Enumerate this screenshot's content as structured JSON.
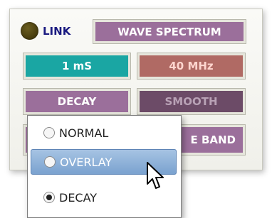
{
  "indicator": {
    "label": "LINK"
  },
  "buttons": {
    "title": "WAVE SPECTRUM",
    "time": "1 mS",
    "freq": "40 MHz",
    "mode": "DECAY",
    "smooth": "SMOOTH",
    "band_partial": "E BAND"
  },
  "menu": {
    "items": [
      {
        "label": "NORMAL",
        "checked": false
      },
      {
        "label": "OVERLAY",
        "checked": false
      },
      {
        "label": "DECAY",
        "checked": true
      }
    ],
    "highlighted": "OVERLAY"
  },
  "colors": {
    "purple": "#9b6f9b",
    "teal": "#1aa6a3",
    "red": "#b06a64",
    "dark_purple": "#6c4b67",
    "highlight": "#7aa2cf"
  },
  "icons": {
    "pointer": "arrow-cursor-icon",
    "led": "indicator-led-icon"
  }
}
